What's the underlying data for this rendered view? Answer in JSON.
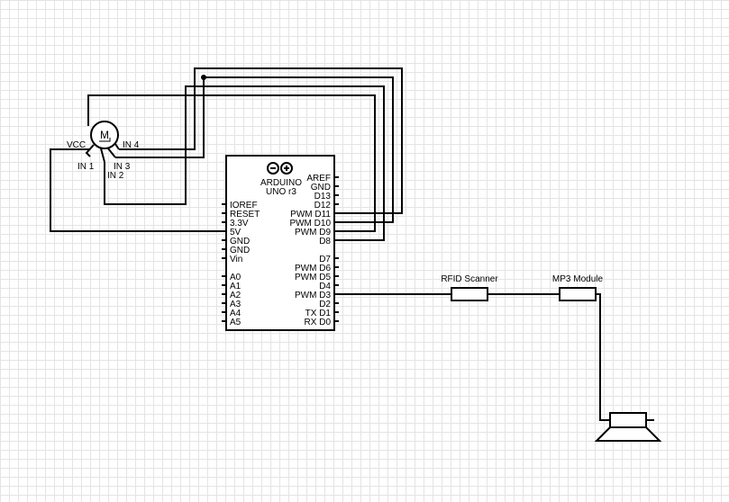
{
  "arduino": {
    "name_line1": "ARDUINO",
    "name_line2": "UNO r3",
    "left_pins": [
      "IOREF",
      "RESET",
      "3.3V",
      "5V",
      "GND",
      "GND",
      "Vin",
      "",
      "A0",
      "A1",
      "A2",
      "A3",
      "A4",
      "A5"
    ],
    "right_pins": [
      "AREF",
      "GND",
      "D13",
      "D12",
      "PWM D11",
      "PWM D10",
      "PWM D9",
      "D8",
      "",
      "D7",
      "PWM D6",
      "PWM D5",
      "D4",
      "PWM D3",
      "D2",
      "TX D1",
      "RX D0"
    ]
  },
  "motor": {
    "symbol": "M",
    "vcc_label": "VCC",
    "in1_label": "IN 1",
    "in2_label": "IN 2",
    "in3_label": "IN 3",
    "in4_label": "IN 4"
  },
  "modules": {
    "rfid_label": "RFID Scanner",
    "mp3_label": "MP3 Module"
  },
  "speaker": {
    "icon": "speaker-icon"
  }
}
